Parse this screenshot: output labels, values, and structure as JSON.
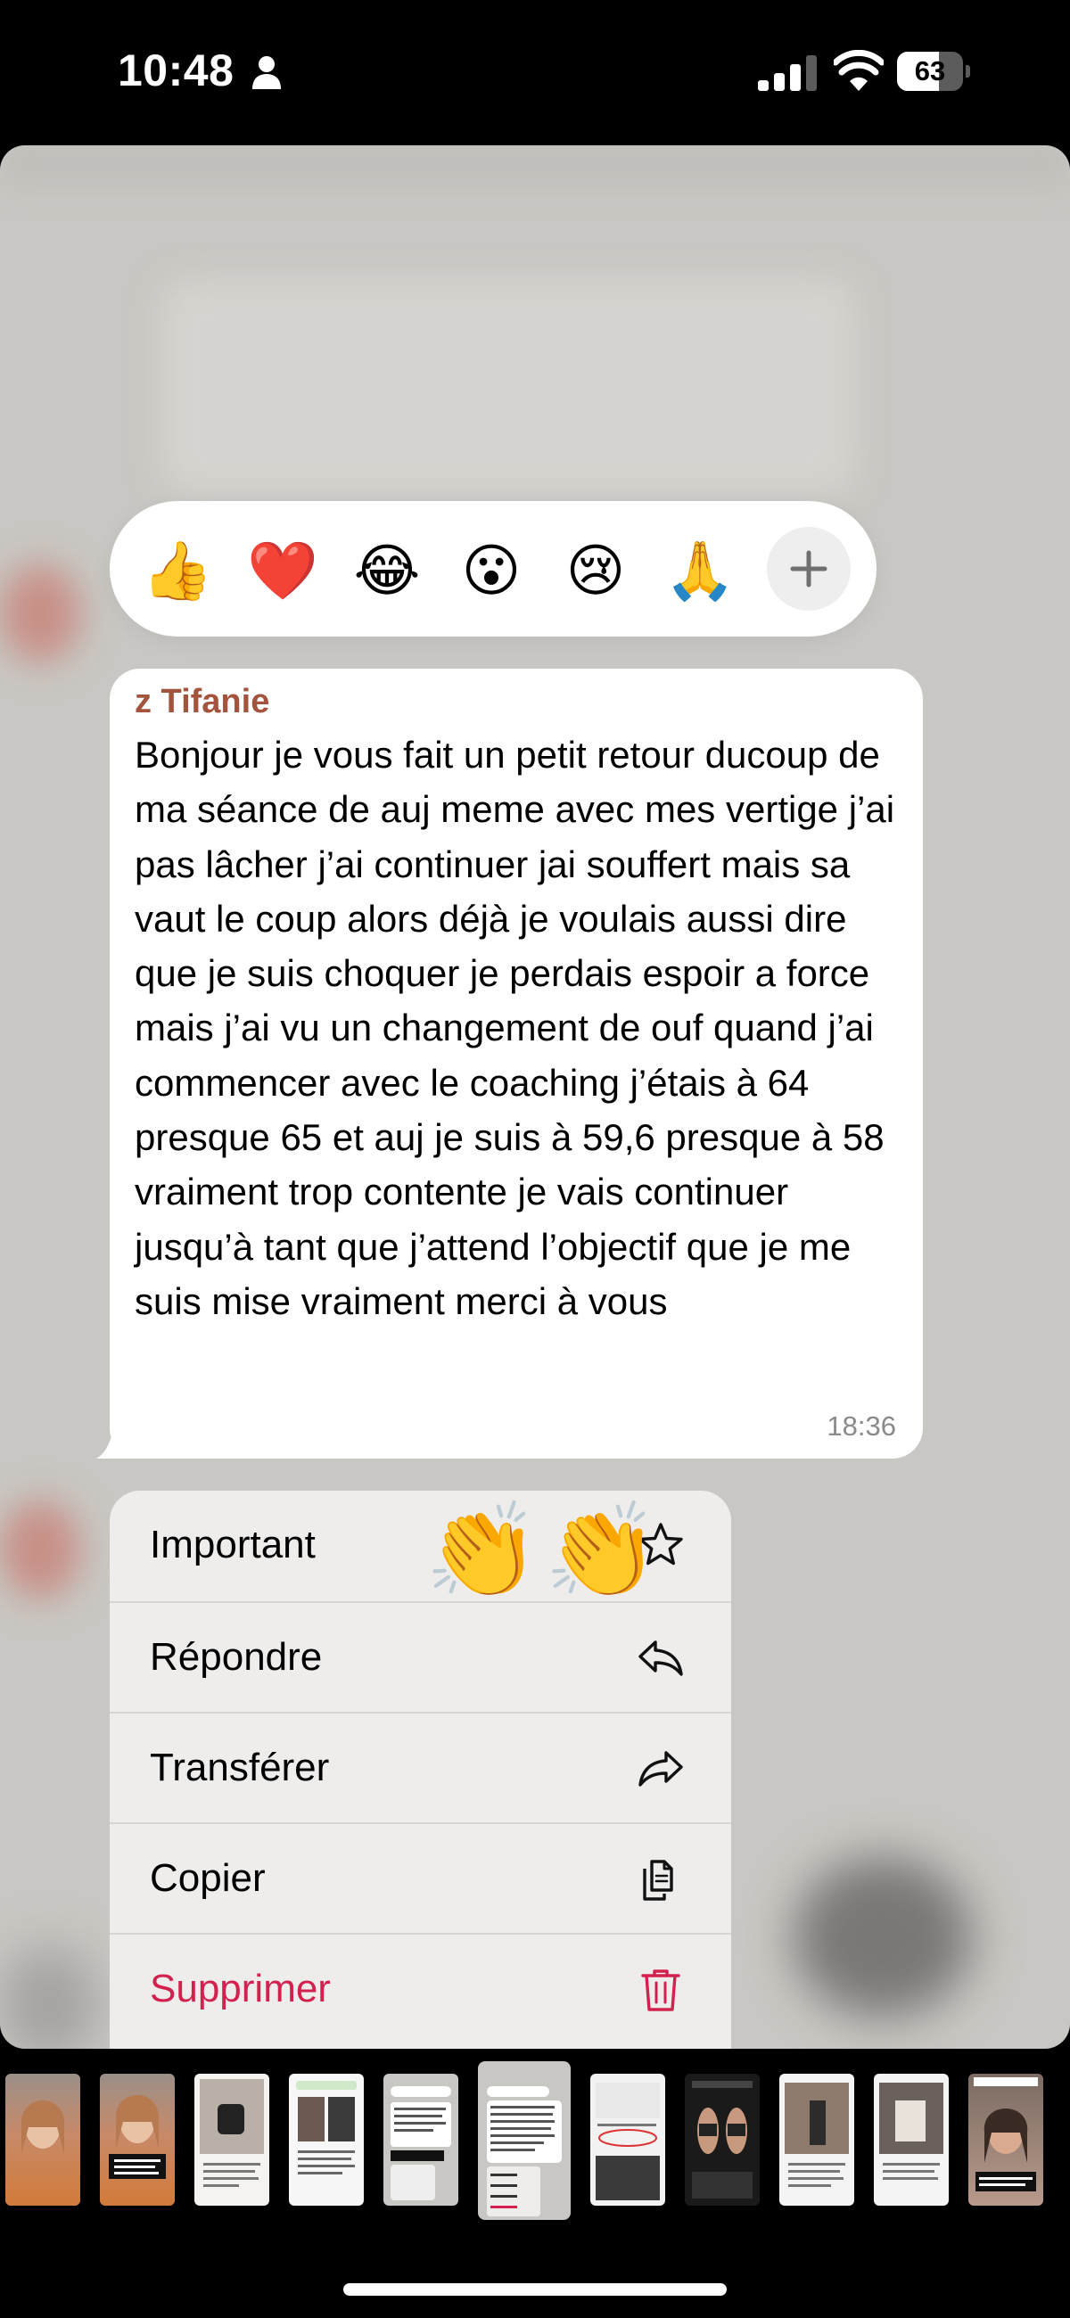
{
  "status_bar": {
    "time": "10:48",
    "battery_level": "63",
    "battery_fraction": 0.63
  },
  "reactions": {
    "items": [
      {
        "emoji": "👍",
        "name": "thumbs-up"
      },
      {
        "emoji": "❤️",
        "name": "red-heart"
      },
      {
        "emoji": "😂",
        "name": "tears-of-joy"
      },
      {
        "emoji": "😮",
        "name": "surprised"
      },
      {
        "emoji": "😢",
        "name": "crying"
      },
      {
        "emoji": "🙏",
        "name": "folded-hands"
      }
    ],
    "add_icon": "plus-icon"
  },
  "message": {
    "sender": "z Tifanie",
    "text": "Bonjour je vous fait un petit retour ducoup de ma séance de auj meme avec mes vertige j’ai pas lâcher j’ai continuer jai souffert mais sa vaut le coup alors déjà je voulais aussi dire que je suis choquer je perdais espoir a force mais j’ai vu un changement de ouf quand j’ai commencer avec le coaching j’étais à 64 presque 65 et auj je suis à 59,6 presque à 58 vraiment trop contente je vais continuer jusqu’à tant que j’attend l’objectif que je me suis mise vraiment merci à vous",
    "time": "18:36",
    "sticker": "👏"
  },
  "menu": {
    "important": {
      "label": "Important",
      "icon": "star-icon"
    },
    "reply": {
      "label": "Répondre",
      "icon": "reply-icon"
    },
    "forward": {
      "label": "Transférer",
      "icon": "forward-icon"
    },
    "copy": {
      "label": "Copier",
      "icon": "copy-icon"
    },
    "delete": {
      "label": "Supprimer",
      "icon": "trash-icon",
      "color": "#d3214f"
    }
  },
  "colors": {
    "sender": "#a4533d",
    "danger": "#d3214f",
    "bubble": "#ffffff",
    "menu": "#eeedec"
  },
  "thumbnail_strip": {
    "count": 11,
    "selected_index": 5
  }
}
